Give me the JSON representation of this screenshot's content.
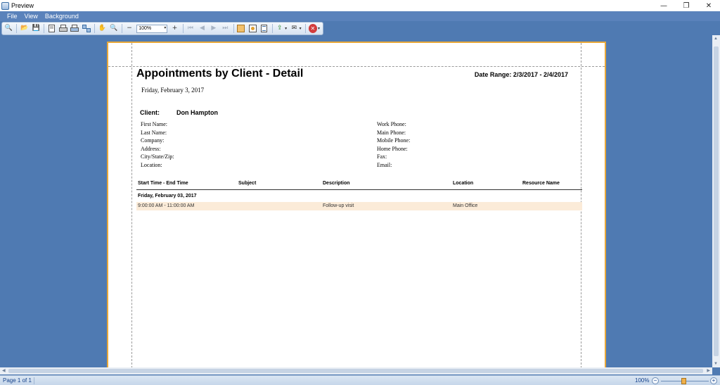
{
  "window": {
    "title": "Preview",
    "minimize_glyph": "—",
    "maximize_glyph": "❐",
    "close_glyph": "✕"
  },
  "menu": {
    "items": [
      "File",
      "View",
      "Background"
    ]
  },
  "toolbar": {
    "zoom_value": "100%",
    "zoom_arrow": "▾",
    "dropdown_arrow": "▾",
    "icons": {
      "search": "🔍",
      "open": "📂",
      "save": "💾",
      "hand": "✋",
      "zoom_out": "−",
      "zoom_in": "+",
      "first": "⏮",
      "prev": "◀",
      "next": "▶",
      "last": "⏭",
      "export": "⇪",
      "email": "✉",
      "close": "✕"
    }
  },
  "report": {
    "title": "Appointments by Client - Detail",
    "date_range": "Date Range: 2/3/2017 - 2/4/2017",
    "date": "Friday, February 3, 2017",
    "client_label": "Client:",
    "client_name": "Don Hampton",
    "left_fields": [
      "First Name:",
      "Last Name:",
      "Company:",
      "Address:",
      "City/State/Zip:",
      "Location:"
    ],
    "right_fields": [
      "Work Phone:",
      "Main Phone:",
      "Mobile Phone:",
      "Home Phone:",
      "Fax:",
      "Email:"
    ],
    "columns": {
      "time": "Start Time - End Time",
      "subject": "Subject",
      "description": "Description",
      "location": "Location",
      "resource": "Resource Name"
    },
    "group_header": "Friday, February 03, 2017",
    "rows": [
      {
        "time": "9:00:00 AM - 11:00:00 AM",
        "subject": "",
        "description": "Follow-up visit",
        "location": "Main Office",
        "resource": ""
      }
    ]
  },
  "status": {
    "page": "Page 1 of 1",
    "zoom": "100%",
    "zoom_minus": "−",
    "zoom_plus": "+"
  },
  "scroll_glyphs": {
    "up": "▲",
    "down": "▼",
    "left": "◀",
    "right": "▶"
  }
}
